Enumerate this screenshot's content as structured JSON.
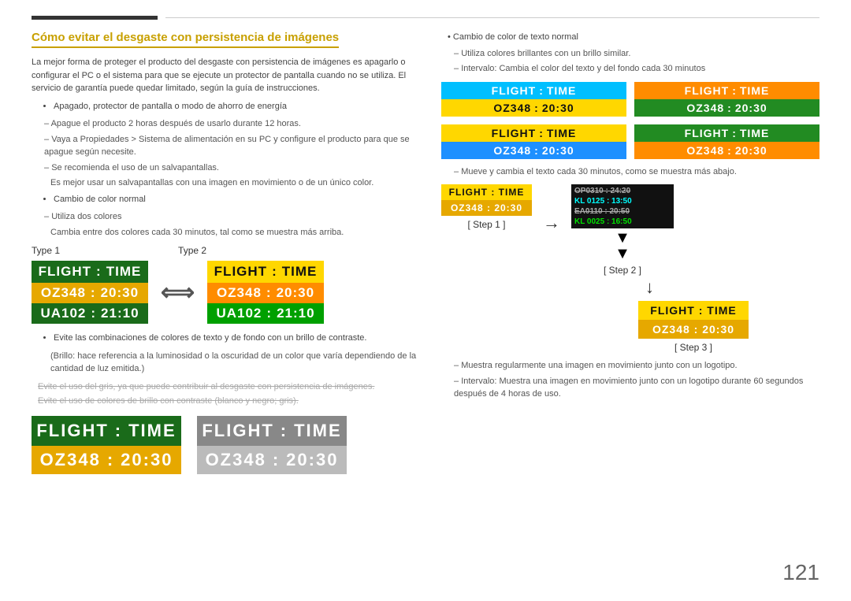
{
  "page": {
    "number": "121",
    "title": "Cómo evitar el desgaste con persistencia de imágenes"
  },
  "left": {
    "intro": "La mejor forma de proteger el producto del desgaste con persistencia de imágenes es apagarlo o configurar el PC o el sistema para que se ejecute un protector de pantalla cuando no se utiliza. El servicio de garantía puede quedar limitado, según la guía de instrucciones.",
    "bullet1_title": "Apagado, protector de pantalla o modo de ahorro de energía",
    "dash1": "Apague el producto 2 horas después de usarlo durante 12 horas.",
    "dash2": "Vaya a Propiedades > Sistema de alimentación en su PC y configure el producto para que se apague según necesite.",
    "dash3": "Se recomienda el uso de un salvapantallas.",
    "dash3b": "Es mejor usar un salvapantallas con una imagen en movimiento o de un único color.",
    "bullet2_title": "Cambio de color normal",
    "dash4": "Utiliza dos colores",
    "dash4b": "Cambia entre dos colores cada 30 minutos, tal como se muestra más arriba.",
    "type1_label": "Type 1",
    "type2_label": "Type 2",
    "flight_label": "FLIGHT",
    "time_label": "TIME",
    "oz348": "OZ348",
    "colon": ":",
    "time1": "20:30",
    "ua102": "UA102",
    "time2": "21:10",
    "note1": "Evite las combinaciones de colores de texto y de fondo con un brillo de contraste.",
    "note1b": "(Brillo: hace referencia a la luminosidad o la oscuridad de un color que varía dependiendo de la cantidad de luz emitida.)",
    "note2": "Evite el uso del gris, ya que puede contribuir al desgaste con persistencia de imágenes.",
    "note3": "Evite el uso de colores de brillo con contraste (blanco y negro; gris).",
    "bottom_lg_1_header": "FLIGHT   :   TIME",
    "bottom_lg_1_row": "OZ348   :   20:30",
    "bottom_lg_2_header": "FLIGHT   :   TIME",
    "bottom_lg_2_row": "OZ348   :   20:30"
  },
  "right": {
    "bullet1": "Cambio de color de texto normal",
    "dash1": "Utiliza colores brillantes con un brillo similar.",
    "dash2": "Intervalo: Cambia el color del texto y del fondo cada 30 minutos",
    "v1_header": "FLIGHT  :  TIME",
    "v1_row": "OZ348  :  20:30",
    "v2_header": "FLIGHT  :  TIME",
    "v2_row": "OZ348  :  20:30",
    "v3_header": "FLIGHT  :  TIME",
    "v3_row": "OZ348  :  20:30",
    "v4_header": "FLIGHT  :  TIME",
    "v4_row": "OZ348  :  20:30",
    "dash3": "Mueve y cambia el texto cada 30 minutos, como se muestra más abajo.",
    "step1_label": "[ Step 1 ]",
    "step2_label": "[ Step 2 ]",
    "step3_label": "[ Step 3 ]",
    "step1_h": "FLIGHT  :  TIME",
    "step1_r": "OZ348  :  20:30",
    "step1_list": [
      {
        "text": "OP0310 : 24:20",
        "class": "s1r-strike"
      },
      {
        "text": "KL 0125 : 13:50",
        "class": "s1r-cyan"
      },
      {
        "text": "EA0110 : 20:50",
        "class": "s1r-strike"
      },
      {
        "text": "KL 0025 : 16:50",
        "class": "s1r-green"
      }
    ],
    "step3_h": "FLIGHT  :  TIME",
    "step3_r": "OZ348  :  20:30",
    "dash4": "Muestra regularmente una imagen en movimiento junto con un logotipo.",
    "dash5": "Intervalo: Muestra una imagen en movimiento junto con un logotipo durante 60 segundos después de 4 horas de uso."
  }
}
